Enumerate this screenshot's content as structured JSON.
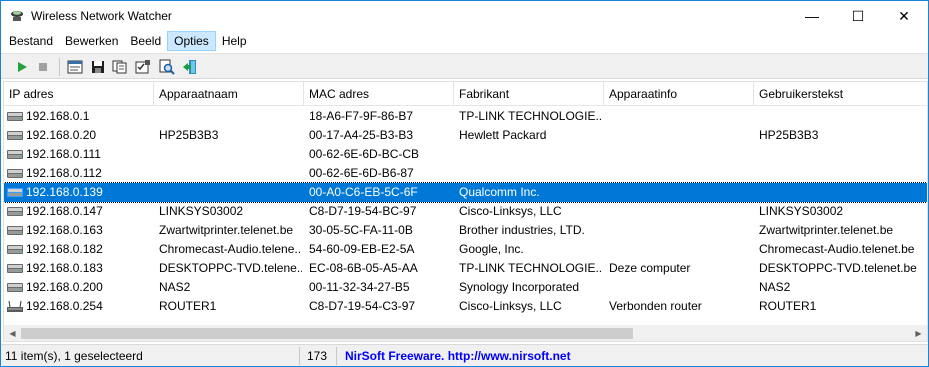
{
  "window": {
    "title": "Wireless Network Watcher",
    "controls": {
      "minimize": "—",
      "maximize": "☐",
      "close": "✕"
    }
  },
  "menu": [
    {
      "label": "Bestand"
    },
    {
      "label": "Bewerken"
    },
    {
      "label": "Beeld"
    },
    {
      "label": "Opties",
      "active": true
    },
    {
      "label": "Help"
    }
  ],
  "toolbar": {
    "buttons": [
      "play-icon",
      "stop-icon",
      "html-report-icon",
      "save-icon",
      "copy-icon",
      "properties-icon",
      "find-icon",
      "exit-icon"
    ]
  },
  "table": {
    "columns": [
      "IP adres",
      "Apparaatnaam",
      "MAC adres",
      "Fabrikant",
      "Apparaatinfo",
      "Gebruikerstekst"
    ],
    "rows": [
      {
        "icon": "computer",
        "ip": "192.168.0.1",
        "name": "",
        "mac": "18-A6-F7-9F-86-B7",
        "vendor": "TP-LINK TECHNOLOGIE...",
        "info": "",
        "user": ""
      },
      {
        "icon": "computer",
        "ip": "192.168.0.20",
        "name": "HP25B3B3",
        "mac": "00-17-A4-25-B3-B3",
        "vendor": "Hewlett Packard",
        "info": "",
        "user": "HP25B3B3"
      },
      {
        "icon": "computer",
        "ip": "192.168.0.111",
        "name": "",
        "mac": "00-62-6E-6D-BC-CB",
        "vendor": "",
        "info": "",
        "user": ""
      },
      {
        "icon": "computer",
        "ip": "192.168.0.112",
        "name": "",
        "mac": "00-62-6E-6D-B6-87",
        "vendor": "",
        "info": "",
        "user": ""
      },
      {
        "icon": "computer",
        "ip": "192.168.0.139",
        "name": "",
        "mac": "00-A0-C6-EB-5C-6F",
        "vendor": "Qualcomm Inc.",
        "info": "",
        "user": "",
        "selected": true
      },
      {
        "icon": "computer",
        "ip": "192.168.0.147",
        "name": "LINKSYS03002",
        "mac": "C8-D7-19-54-BC-97",
        "vendor": "Cisco-Linksys, LLC",
        "info": "",
        "user": "LINKSYS03002"
      },
      {
        "icon": "computer",
        "ip": "192.168.0.163",
        "name": "Zwartwitprinter.telenet.be",
        "mac": "30-05-5C-FA-11-0B",
        "vendor": "Brother industries, LTD.",
        "info": "",
        "user": "Zwartwitprinter.telenet.be"
      },
      {
        "icon": "computer",
        "ip": "192.168.0.182",
        "name": "Chromecast-Audio.telene...",
        "mac": "54-60-09-EB-E2-5A",
        "vendor": "Google, Inc.",
        "info": "",
        "user": "Chromecast-Audio.telenet.be"
      },
      {
        "icon": "computer",
        "ip": "192.168.0.183",
        "name": "DESKTOPPC-TVD.telene...",
        "mac": "EC-08-6B-05-A5-AA",
        "vendor": "TP-LINK TECHNOLOGIE...",
        "info": "Deze computer",
        "user": "DESKTOPPC-TVD.telenet.be"
      },
      {
        "icon": "computer",
        "ip": "192.168.0.200",
        "name": "NAS2",
        "mac": "00-11-32-34-27-B5",
        "vendor": "Synology Incorporated",
        "info": "",
        "user": "NAS2"
      },
      {
        "icon": "router",
        "ip": "192.168.0.254",
        "name": "ROUTER1",
        "mac": "C8-D7-19-54-C3-97",
        "vendor": "Cisco-Linksys, LLC",
        "info": "Verbonden router",
        "user": "ROUTER1"
      }
    ]
  },
  "status": {
    "count_text": "11 item(s), 1 geselecteerd",
    "number": "173",
    "credit": "NirSoft Freeware.  http://www.nirsoft.net"
  },
  "colors": {
    "selection": "#0078d7",
    "play": "#22a33a",
    "link": "#0000ff"
  }
}
